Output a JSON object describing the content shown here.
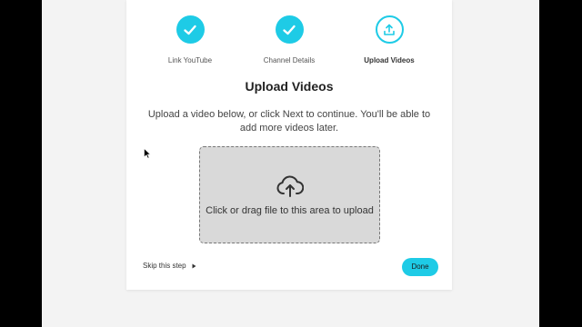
{
  "stepper": {
    "steps": [
      {
        "label": "Link YouTube",
        "state": "completed",
        "icon": "check-icon"
      },
      {
        "label": "Channel Details",
        "state": "completed",
        "icon": "check-icon"
      },
      {
        "label": "Upload Videos",
        "state": "current",
        "icon": "upload-icon"
      }
    ]
  },
  "main": {
    "title": "Upload Videos",
    "description": "Upload a video below, or click Next to continue. You'll be able to add more videos later.",
    "dropzone": {
      "icon": "cloud-upload-icon",
      "hint": "Click or drag file to this area to upload"
    }
  },
  "footer": {
    "skip_label": "Skip this step",
    "skip_icon": "caret-right-icon",
    "done_label": "Done"
  },
  "colors": {
    "accent": "#1ecbe6",
    "dropzone_bg": "#d9d9d9",
    "page_bg": "#f3f3f3"
  }
}
